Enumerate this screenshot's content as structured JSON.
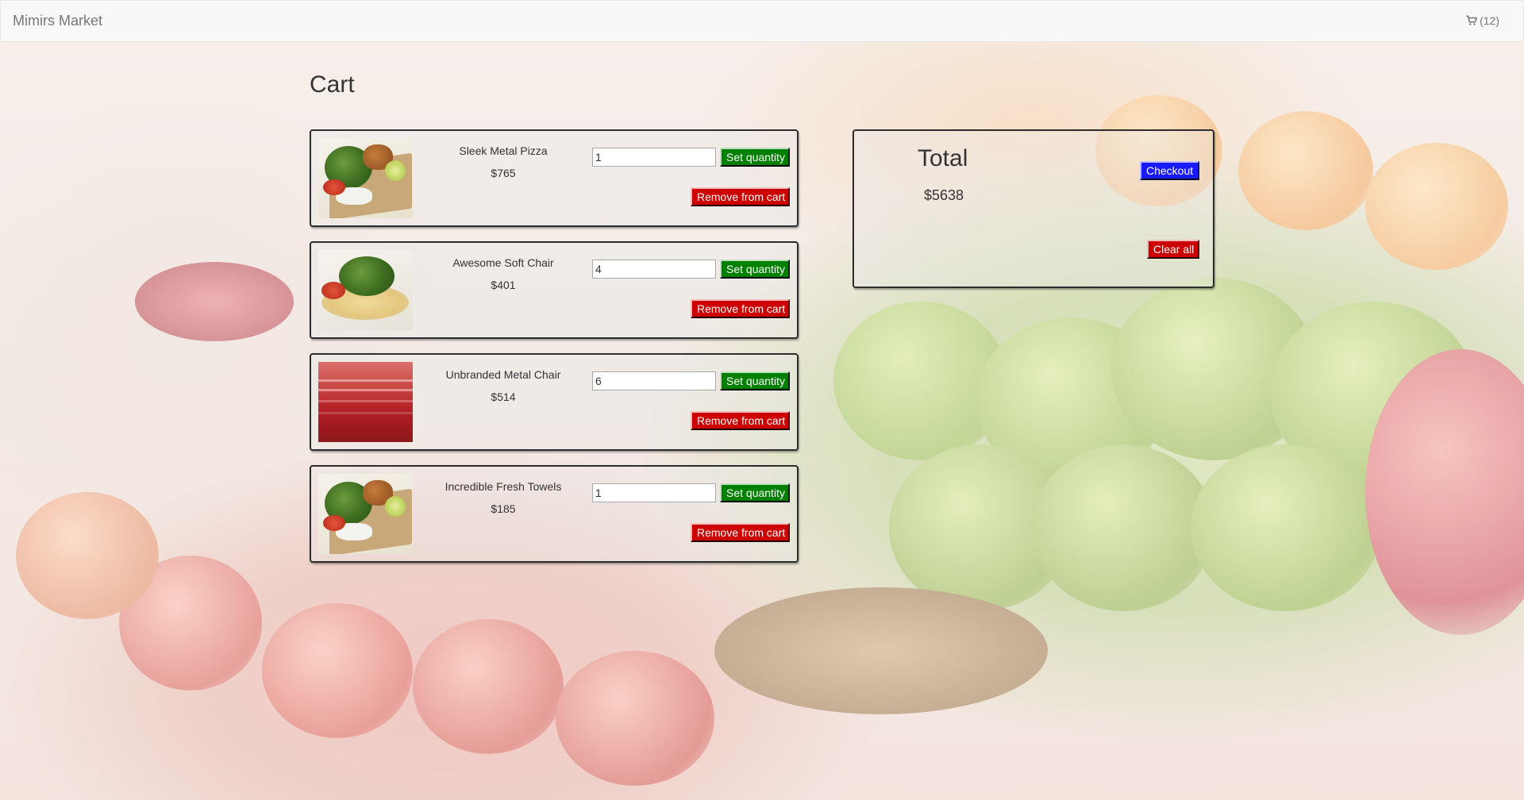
{
  "navbar": {
    "brand": "Mimirs Market",
    "cart_icon": "shopping-cart-icon",
    "cart_count": "(12)"
  },
  "page": {
    "title": "Cart"
  },
  "cart": {
    "items": [
      {
        "name": "Sleek Metal Pizza",
        "price": "$765",
        "quantity": "1",
        "image": "food-plate-image",
        "set_label": "Set quantity",
        "remove_label": "Remove from cart"
      },
      {
        "name": "Awesome Soft Chair",
        "price": "$401",
        "quantity": "4",
        "image": "salad-plate-image",
        "set_label": "Set quantity",
        "remove_label": "Remove from cart"
      },
      {
        "name": "Unbranded Metal Chair",
        "price": "$514",
        "quantity": "6",
        "image": "red-stripes-image",
        "set_label": "Set quantity",
        "remove_label": "Remove from cart"
      },
      {
        "name": "Incredible Fresh Towels",
        "price": "$185",
        "quantity": "1",
        "image": "food-plate-image",
        "set_label": "Set quantity",
        "remove_label": "Remove from cart"
      }
    ]
  },
  "summary": {
    "title": "Total",
    "amount": "$5638",
    "checkout_label": "Checkout",
    "clear_label": "Clear all"
  },
  "colors": {
    "set_button": "#008000",
    "remove_button": "#cc0000",
    "checkout_button": "#1a1aff",
    "navbar_bg": "#f8f8f8",
    "brand_text": "#777777"
  }
}
